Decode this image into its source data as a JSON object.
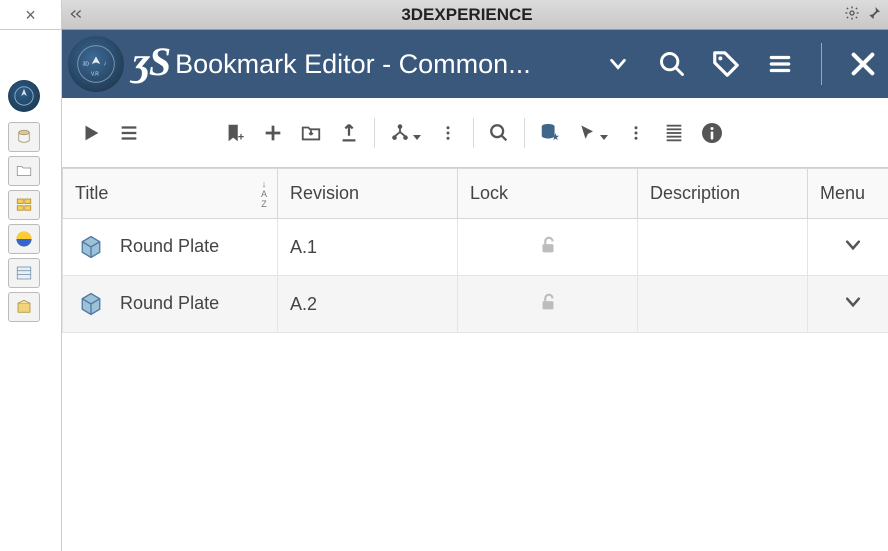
{
  "titlebar": {
    "text": "3DEXPERIENCE"
  },
  "header": {
    "app_title": "Bookmark Editor - Common..."
  },
  "columns": {
    "title": "Title",
    "revision": "Revision",
    "lock": "Lock",
    "description": "Description",
    "menu": "Menu"
  },
  "rows": [
    {
      "title": "Round Plate",
      "revision": "A.1",
      "description": ""
    },
    {
      "title": "Round Plate",
      "revision": "A.2",
      "description": ""
    }
  ]
}
